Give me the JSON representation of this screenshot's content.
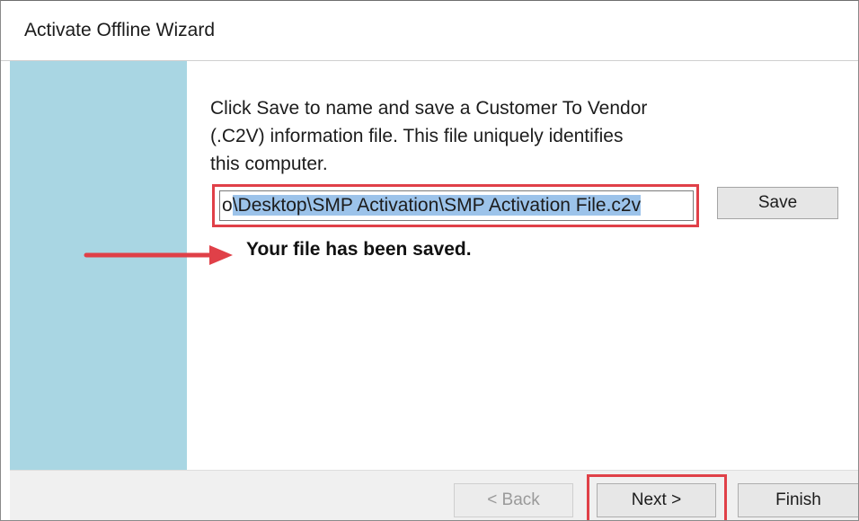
{
  "window": {
    "title": "Activate Offline Wizard"
  },
  "instructions": {
    "line1": "Click Save to name and save a Customer To Vendor",
    "line2": "(.C2V) information file.  This file uniquely identifies",
    "line3": "this computer."
  },
  "file_path": {
    "leading_char": "o",
    "selected_text": "\\Desktop\\SMP Activation\\SMP Activation File.c2v"
  },
  "save_button": {
    "label": "Save"
  },
  "status": {
    "message": "Your file has been saved."
  },
  "footer": {
    "back_label": "< Back",
    "next_label": "Next >",
    "finish_label": "Finish"
  },
  "colors": {
    "sidebar": "#a9d6e3",
    "highlight": "#e04048",
    "selection": "#9cc3ea"
  }
}
